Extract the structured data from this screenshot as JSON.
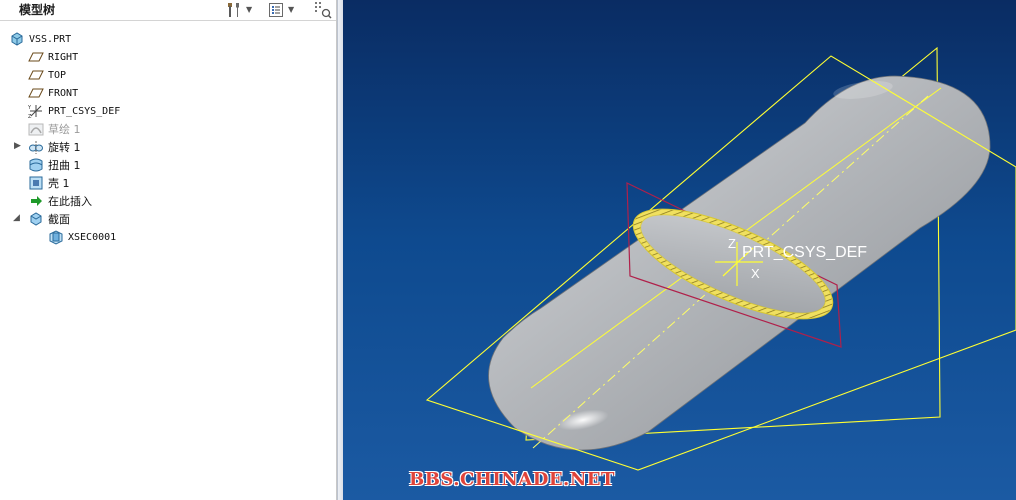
{
  "panel": {
    "title": "模型树"
  },
  "tree": {
    "root": "VSS.PRT",
    "items": [
      {
        "label": "RIGHT",
        "icon": "datum-plane-icon"
      },
      {
        "label": "TOP",
        "icon": "datum-plane-icon"
      },
      {
        "label": "FRONT",
        "icon": "datum-plane-icon"
      },
      {
        "label": "PRT_CSYS_DEF",
        "icon": "coordinate-system-icon"
      },
      {
        "label": "草绘 1",
        "icon": "sketch-icon"
      },
      {
        "label": "旋转 1",
        "icon": "revolve-icon"
      },
      {
        "label": "扭曲 1",
        "icon": "warp-icon"
      },
      {
        "label": "壳 1",
        "icon": "shell-icon"
      },
      {
        "label": "在此插入",
        "icon": "insert-here-arrow-icon"
      },
      {
        "label": "截面",
        "icon": "section-folder-icon"
      },
      {
        "label": "XSEC0001",
        "icon": "cross-section-icon"
      }
    ]
  },
  "viewport": {
    "csys_label": "PRT_CSYS_DEF",
    "axis_z": "Z",
    "axis_x": "X",
    "watermark": "BBS.CHINADE.NET",
    "colors": {
      "background_top": "#0a2c63",
      "background_bottom": "#1b5aa3",
      "datum_plane": "#ffff33",
      "section_plane": "#b0204a",
      "body": "#b9bcc0"
    }
  }
}
